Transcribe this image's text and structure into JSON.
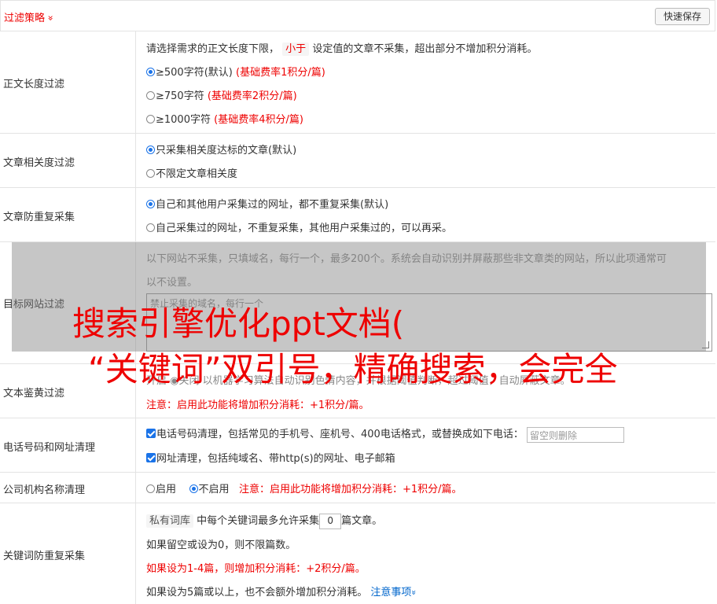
{
  "header": {
    "title": "过滤策略",
    "chevron": "»",
    "save_label": "快速保存"
  },
  "length_filter": {
    "label": "正文长度过滤",
    "desc_pre": "请选择需求的正文长度下限，",
    "desc_tag": "小于",
    "desc_post": "设定值的文章不采集，超出部分不增加积分消耗。",
    "options": [
      {
        "text": "≥500字符(默认)",
        "cost": "(基础费率1积分/篇)",
        "checked": true
      },
      {
        "text": "≥750字符",
        "cost": "(基础费率2积分/篇)",
        "checked": false
      },
      {
        "text": "≥1000字符",
        "cost": "(基础费率4积分/篇)",
        "checked": false
      }
    ]
  },
  "relevance_filter": {
    "label": "文章相关度过滤",
    "options": [
      {
        "text": "只采集相关度达标的文章(默认)",
        "checked": true
      },
      {
        "text": "不限定文章相关度",
        "checked": false
      }
    ]
  },
  "dedup": {
    "label": "文章防重复采集",
    "options": [
      {
        "text": "自己和其他用户采集过的网址，都不重复采集(默认)",
        "checked": true
      },
      {
        "text": "自己采集过的网址，不重复采集，其他用户采集过的，可以再采。",
        "checked": false
      }
    ]
  },
  "site_filter": {
    "label": "目标网站过滤",
    "desc_line1": "以下网站不采集，只填域名，每行一个，最多200个。系统会自动识别并屏蔽那些非文章类的网站，所以此项通常可",
    "desc_line2": "以不设置。",
    "placeholder": "禁止采集的域名，每行一个"
  },
  "overlay_text": {
    "line1": "搜索引擎优化ppt文档(",
    "line2": "“关键词”双引号，精确搜索，会完全"
  },
  "porn_filter": {
    "label": "文本鉴黄过滤",
    "obscured": "开启  ◉关闭  以机器学习算法自动识别色情内容，并根据阈值判断，超过阈值，自动屏蔽文章。",
    "note": "注意：启用此功能将增加积分消耗：+1积分/篇。"
  },
  "phone_url": {
    "label": "电话号码和网址清理",
    "phone_text": "电话号码清理，包括常见的手机号、座机号、400电话格式，或替换成如下电话：",
    "phone_placeholder": "留空则删除",
    "url_text": "网址清理，包括纯域名、带http(s)的网址、电子邮箱"
  },
  "company": {
    "label": "公司机构名称清理",
    "on_text": "启用",
    "off_text": "不启用",
    "note": "注意：启用此功能将增加积分消耗：+1积分/篇。"
  },
  "keyword_dedup": {
    "label": "关键词防重复采集",
    "tag": "私有词库",
    "text_pre": "中每个关键词最多允许采集",
    "value": "0",
    "text_post": "篇文章。",
    "line2": "如果留空或设为0，则不限篇数。",
    "line3": "如果设为1-4篇，则增加积分消耗：+2积分/篇。",
    "line4": "如果设为5篇或以上，也不会额外增加积分消耗。",
    "link": "注意事项",
    "link_chev": "»"
  },
  "colors": {
    "accent": "#e00000",
    "check": "#1a73e8",
    "link": "#0066cc"
  }
}
